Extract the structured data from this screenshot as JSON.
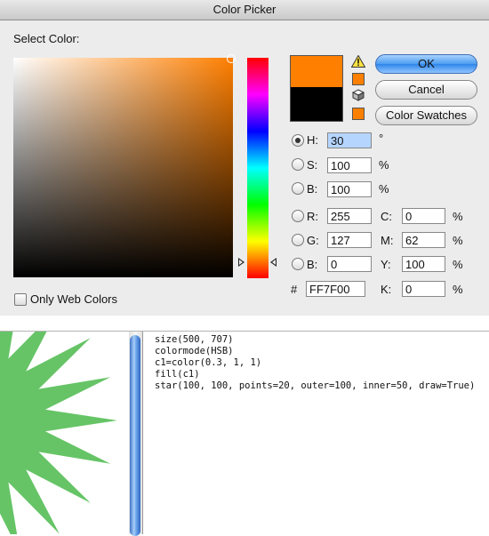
{
  "dialog": {
    "title": "Color Picker",
    "select_label": "Select Color:",
    "only_web_colors": "Only Web Colors",
    "buttons": {
      "ok": "OK",
      "cancel": "Cancel",
      "swatches": "Color Swatches"
    },
    "new_color": "#ff7f00",
    "old_color": "#000000",
    "hue_marker_color": "#ff7f00",
    "hsb": [
      {
        "label": "H:",
        "value": "30",
        "unit": "°",
        "selected": true
      },
      {
        "label": "S:",
        "value": "100",
        "unit": "%"
      },
      {
        "label": "B:",
        "value": "100",
        "unit": "%"
      }
    ],
    "rgb": [
      {
        "label": "R:",
        "value": "255"
      },
      {
        "label": "G:",
        "value": "127"
      },
      {
        "label": "B:",
        "value": "0"
      }
    ],
    "cmyk": [
      {
        "label": "C:",
        "value": "0",
        "unit": "%"
      },
      {
        "label": "M:",
        "value": "62",
        "unit": "%"
      },
      {
        "label": "Y:",
        "value": "100",
        "unit": "%"
      },
      {
        "label": "K:",
        "value": "0",
        "unit": "%"
      }
    ],
    "hex": {
      "label": "#",
      "value": "FF7F00"
    }
  },
  "editor": {
    "star_color": "#66c466",
    "code": [
      {
        "plain": "size(500, 707)"
      },
      {
        "plain": "colormode(HSB)"
      },
      {
        "plain": "c1=color(0.3, 1, 1)"
      },
      {
        "plain": "fill(c1)"
      },
      {
        "plain": "star(100, 100, points=20, outer=100, inner=50, draw=True)"
      }
    ]
  }
}
